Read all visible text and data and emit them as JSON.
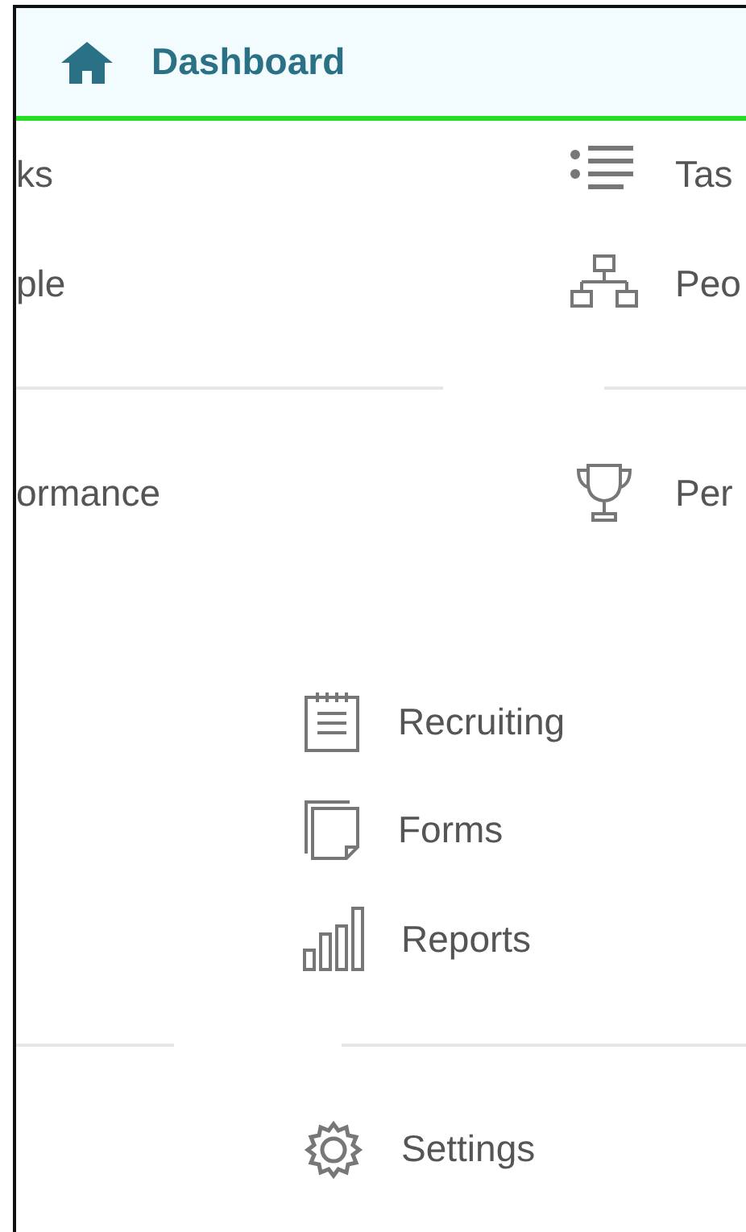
{
  "header": {
    "title": "Dashboard"
  },
  "left_items": [
    {
      "label": "ks"
    },
    {
      "label": "ple"
    },
    {
      "label": "ormance"
    }
  ],
  "right_items": [
    {
      "label": "Tas"
    },
    {
      "label": "Peo"
    },
    {
      "label": "Per"
    }
  ],
  "middle_items": [
    {
      "label": "Recruiting"
    },
    {
      "label": "Forms"
    },
    {
      "label": "Reports"
    },
    {
      "label": "Settings"
    }
  ]
}
